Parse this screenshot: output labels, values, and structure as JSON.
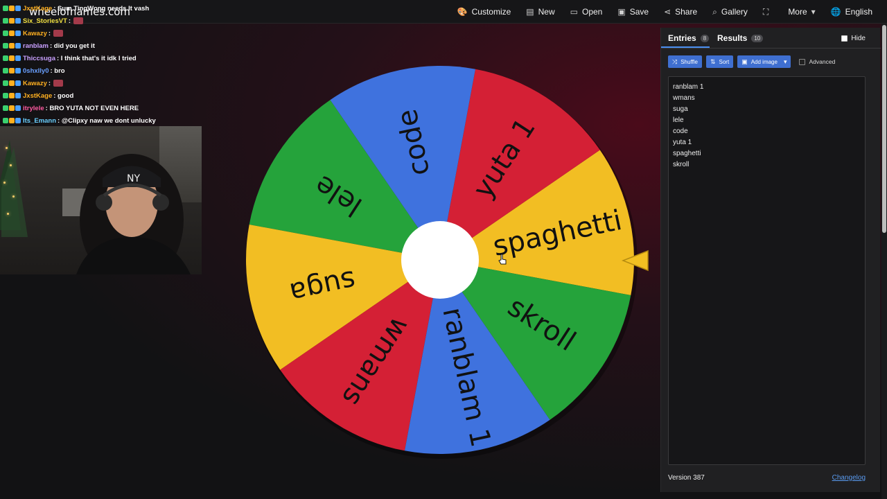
{
  "site": {
    "title": "wheelofnames.com"
  },
  "nav": [
    {
      "label": "Customize",
      "icon": "palette-icon",
      "glyph": "🎨"
    },
    {
      "label": "New",
      "icon": "file-icon",
      "glyph": "▤"
    },
    {
      "label": "Open",
      "icon": "folder-icon",
      "glyph": "▭"
    },
    {
      "label": "Save",
      "icon": "save-icon",
      "glyph": "▣"
    },
    {
      "label": "Share",
      "icon": "share-icon",
      "glyph": "⋖"
    },
    {
      "label": "Gallery",
      "icon": "search-icon",
      "glyph": "⌕"
    },
    {
      "label": "",
      "icon": "fullscreen-icon",
      "glyph": "⛶"
    },
    {
      "label": "More",
      "icon": "chevron-down-icon",
      "glyph": "▾"
    },
    {
      "label": "English",
      "icon": "globe-icon",
      "glyph": "🌐"
    }
  ],
  "chat": [
    {
      "user": "JxstKage",
      "color": "#ffb020",
      "msg": ": Sum TingWong needs It vash"
    },
    {
      "user": "Six_StoriesVT",
      "color": "#f0e040",
      "msg": ":",
      "emote": true
    },
    {
      "user": "Kawazy",
      "color": "#ffb020",
      "msg": ":",
      "emote": true
    },
    {
      "user": "ranblam",
      "color": "#c9a0ff",
      "msg": ": did you get it"
    },
    {
      "user": "Thiccsuga",
      "color": "#c9a0ff",
      "msg": ": I think that's it idk I tried"
    },
    {
      "user": "0shxlly0",
      "color": "#6aa0ff",
      "msg": ": bro"
    },
    {
      "user": "Kawazy",
      "color": "#ffb020",
      "msg": ":",
      "emote": true
    },
    {
      "user": "JxstKage",
      "color": "#ffb020",
      "msg": ": good"
    },
    {
      "user": "itrylele",
      "color": "#ff5aa0",
      "msg": ": BRO YUTA NOT EVEN HERE"
    },
    {
      "user": "Its_Emann",
      "color": "#6ad0ff",
      "msg": ": @Clipxy naw we dont unlucky"
    }
  ],
  "wheel": {
    "segments": [
      {
        "label": "spaghetti",
        "color": "#f2be23"
      },
      {
        "label": "yuta 1",
        "color": "#d42035"
      },
      {
        "label": "code",
        "color": "#3f72de"
      },
      {
        "label": "lele",
        "color": "#25a33b"
      },
      {
        "label": "suga",
        "color": "#f2be23"
      },
      {
        "label": "wmans",
        "color": "#d42035"
      },
      {
        "label": "ranblam 1",
        "color": "#3f72de"
      },
      {
        "label": "skroll",
        "color": "#25a33b"
      }
    ],
    "rotation_deg": 12
  },
  "panel": {
    "tabs": [
      {
        "label": "Entries",
        "count": "8"
      },
      {
        "label": "Results",
        "count": "10"
      }
    ],
    "hide_label": "Hide",
    "toolbar": {
      "shuffle": "Shuffle",
      "sort": "Sort",
      "add_image": "Add image",
      "advanced": "Advanced"
    },
    "entries": [
      "ranblam 1",
      "wmans",
      "suga",
      "lele",
      "code",
      "yuta 1",
      "spaghetti",
      "skroll"
    ],
    "version": "Version 387",
    "changelog": "Changelog"
  }
}
